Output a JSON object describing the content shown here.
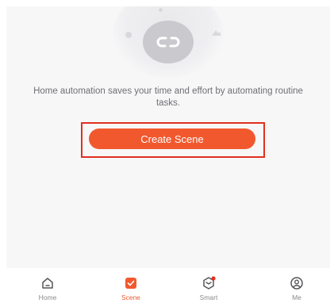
{
  "main": {
    "description": "Home automation saves your time and effort by automating routine tasks.",
    "create_button_label": "Create Scene"
  },
  "tabbar": {
    "items": [
      {
        "label": "Home",
        "icon": "home-icon",
        "active": false
      },
      {
        "label": "Scene",
        "icon": "scene-check-icon",
        "active": true
      },
      {
        "label": "Smart",
        "icon": "smart-cube-icon",
        "active": false,
        "badge": true
      },
      {
        "label": "Me",
        "icon": "profile-icon",
        "active": false
      }
    ]
  },
  "colors": {
    "accent": "#f2582e",
    "highlight_border": "#e0301e",
    "text_muted": "#6f6f74",
    "background": "#f7f7f8"
  }
}
